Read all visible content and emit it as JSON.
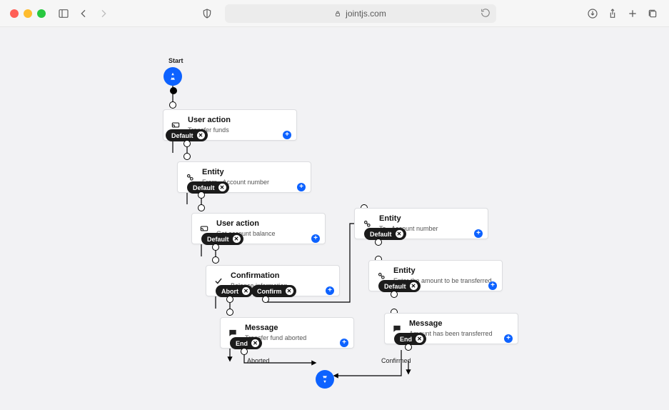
{
  "browser": {
    "url_text": "jointjs.com"
  },
  "start_label": "Start",
  "nodes": {
    "n1": {
      "title": "User action",
      "sub": "Transfer funds"
    },
    "n2": {
      "title": "Entity",
      "sub": "From - Account number"
    },
    "n3": {
      "title": "User action",
      "sub": "Get account balance"
    },
    "n4": {
      "title": "Confirmation",
      "sub": "Balance information"
    },
    "n5": {
      "title": "Message",
      "sub": "Transfer fund aborted"
    },
    "n6": {
      "title": "Entity",
      "sub": "To - Account number"
    },
    "n7": {
      "title": "Entity",
      "sub": "Enter the amount to be transferred"
    },
    "n8": {
      "title": "Message",
      "sub": "Amount has been transferred"
    }
  },
  "tags": {
    "t1": "Default",
    "t2": "Default",
    "t3": "Default",
    "t4a": "Abort",
    "t4b": "Confirm",
    "t5": "End",
    "t6": "Default",
    "t7": "Default",
    "t8": "End"
  },
  "edge_labels": {
    "aborted": "Aborted",
    "confirmed": "Confirmed"
  }
}
